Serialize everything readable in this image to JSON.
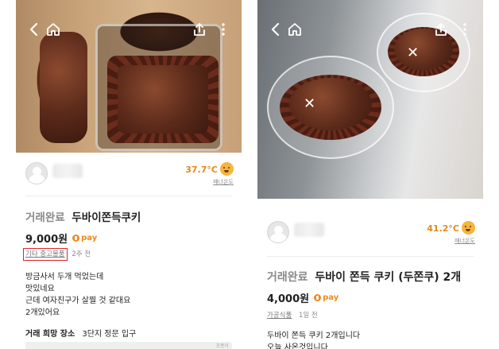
{
  "left": {
    "nav": {
      "back_icon": "chevron-left-icon",
      "home_icon": "home-icon",
      "share_icon": "share-icon",
      "more_icon": "more-vertical-icon"
    },
    "seller": {
      "temperature": "37.7°C",
      "manner_label": "매너온도"
    },
    "listing": {
      "status": "거래완료",
      "title": "두바이쫀득쿠키",
      "price": "9,000원",
      "pay_label": "pay",
      "category": "기타 중고물품",
      "posted": "2주 전",
      "description": [
        "방금사서 두개 먹었는데",
        "맛있네요",
        "근데 여자친구가 살찔 것 같대요",
        "2개있어요"
      ],
      "meetup_label": "거래 희망 장소",
      "meetup_value": "3단지 정문 입구",
      "map_label": "포퐁아"
    }
  },
  "right": {
    "nav": {
      "back_icon": "chevron-left-icon",
      "home_icon": "home-icon",
      "share_icon": "share-icon",
      "more_icon": "more-vertical-icon"
    },
    "seller": {
      "temperature": "41.2°C",
      "manner_label": "매너온도"
    },
    "listing": {
      "status": "거래완료",
      "title": "두바이 쫀득 쿠키 (두쫀쿠) 2개",
      "price": "4,000원",
      "pay_label": "pay",
      "category": "가공식품",
      "posted": "1일 전",
      "description": [
        "두바이 쫀득 쿠키 2개입니다",
        "오늘 사온것입니다"
      ]
    }
  },
  "colors": {
    "accent": "#ef8a1f",
    "temperature": "#e38a19",
    "highlight_box": "#d7262e",
    "muted_text": "#8a8a8a"
  }
}
